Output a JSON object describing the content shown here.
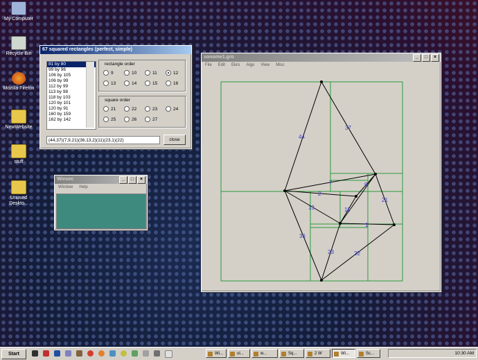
{
  "desktop": {
    "icons": [
      {
        "label": "My Computer"
      },
      {
        "label": "Recycle Bin"
      },
      {
        "label": "Mozilla Firefox"
      },
      {
        "label": "NewWebsite"
      },
      {
        "label": "stuff"
      },
      {
        "label": "Unused Deskto..."
      }
    ]
  },
  "dialog": {
    "title": "67 squared rectangles (perfect, simple)",
    "list_items": [
      "81 by 80",
      "99 by 96",
      "106 by 105",
      "106 by 99",
      "112 by 99",
      "113 by 98",
      "118 by 103",
      "120 by 101",
      "120 by 91",
      "160 by 159",
      "162 by 142"
    ],
    "selected_index": 0,
    "rect_order_label": "rectangle order",
    "rect_orders": [
      "9",
      "10",
      "11",
      "12",
      "13",
      "14",
      "15",
      "16"
    ],
    "rect_order_selected": "12",
    "square_order_label": "square order",
    "square_orders": [
      "21",
      "22",
      "23",
      "24",
      "25",
      "26",
      "27"
    ],
    "code_value": "(44,37)(7,9,21)(36,13,2)(11)(23,1)(22)",
    "close_label": "close"
  },
  "winsec": {
    "title": "Winsec",
    "menu": [
      "Window",
      "Help"
    ]
  },
  "sonome": {
    "title": "sonome1.gro",
    "menu": [
      "File",
      "Edit",
      "Ekro",
      "Algo",
      "View",
      "Misc"
    ],
    "edge_labels": [
      "44",
      "37",
      "7",
      "9",
      "2",
      "21",
      "13",
      "11",
      "1",
      "36",
      "23",
      "22"
    ]
  },
  "taskbar": {
    "start_label": "Start",
    "tasks": [
      "Wi...",
      "ul...",
      "w...",
      "Sq...",
      "2 W",
      "Wi...",
      "Sc..."
    ],
    "active_task": 5,
    "clock": "10:30 AM"
  },
  "colors": {
    "accent_title": "#0a246a",
    "graph_line": "#2a9a3a",
    "edge_label": "#3a3ad0",
    "winsec_body": "#3e8a7e"
  }
}
